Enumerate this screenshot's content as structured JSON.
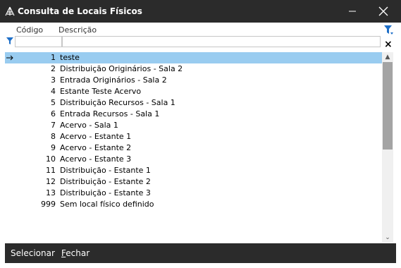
{
  "window": {
    "title": "Consulta de Locais Físicos",
    "minimize_icon": "minimize-icon",
    "close_icon": "close-icon"
  },
  "grid": {
    "columns": [
      "Código",
      "Descrição"
    ],
    "filter": {
      "codigo_value": "",
      "descricao_value": ""
    },
    "rows": [
      {
        "codigo": "1",
        "descricao": "teste",
        "selected": true
      },
      {
        "codigo": "2",
        "descricao": "Distribuição Originários - Sala 2"
      },
      {
        "codigo": "3",
        "descricao": "Entrada Originários - Sala 2"
      },
      {
        "codigo": "4",
        "descricao": "Estante Teste Acervo"
      },
      {
        "codigo": "5",
        "descricao": "Distribuição Recursos - Sala 1"
      },
      {
        "codigo": "6",
        "descricao": "Entrada Recursos - Sala 1"
      },
      {
        "codigo": "7",
        "descricao": "Acervo - Sala 1"
      },
      {
        "codigo": "8",
        "descricao": "Acervo - Estante 1"
      },
      {
        "codigo": "9",
        "descricao": "Acervo - Estante 2"
      },
      {
        "codigo": "10",
        "descricao": "Acervo - Estante 3"
      },
      {
        "codigo": "11",
        "descricao": "Distribuição - Estante 1"
      },
      {
        "codigo": "12",
        "descricao": "Distribuição - Estante 2"
      },
      {
        "codigo": "13",
        "descricao": "Distribuição - Estante 3"
      },
      {
        "codigo": "999",
        "descricao": "Sem local físico definido"
      }
    ]
  },
  "side_tools": {
    "clear_label": "×"
  },
  "footer": {
    "select_label": "Selecionar",
    "close_first": "F",
    "close_rest": "echar"
  },
  "colors": {
    "titlebar": "#2b2b2b",
    "selected_row": "#99ccf0",
    "filter_icon": "#1e6fc8",
    "scroll_thumb": "#a4a4a4"
  }
}
